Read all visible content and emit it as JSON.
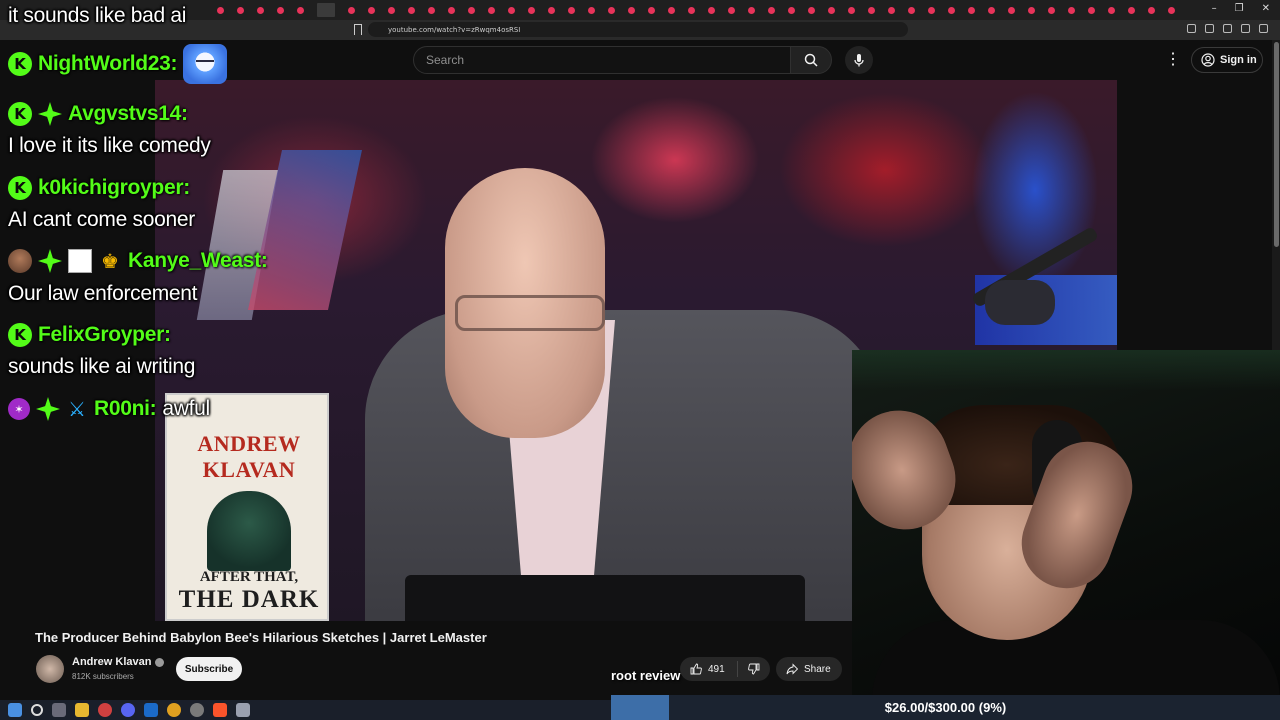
{
  "browser": {
    "url": "youtube.com/watch?v=zRwqm4osRSI"
  },
  "youtube": {
    "search_placeholder": "Search",
    "sign_in": "Sign in",
    "video_title": "The Producer Behind Babylon Bee's Hilarious Sketches | Jarret LeMaster",
    "channel_name": "Andrew Klavan",
    "subscribers": "812K subscribers",
    "subscribe": "Subscribe",
    "likes": "491",
    "share": "Share"
  },
  "book": {
    "author_line1": "ANDREW",
    "author_line2": "KLAVAN",
    "title_line1": "AFTER THAT,",
    "title_line2": "THE DARK"
  },
  "chat": {
    "messages": [
      {
        "text": "it sounds like bad ai"
      },
      {
        "user": "NightWorld23:"
      },
      {
        "user": "Avgvstvs14:",
        "text": "I love it its like comedy"
      },
      {
        "user": "k0kichigroyper:",
        "text": "AI cant come sooner"
      },
      {
        "user": "Kanye_Weast:",
        "text": "Our law enforcement"
      },
      {
        "user": "FelixGroyper:",
        "text": "sounds like ai writing"
      },
      {
        "user": "R00ni:",
        "text": "awful"
      }
    ]
  },
  "overlay": {
    "root_review": "root review",
    "goal_text": "$26.00/$300.00 (9%)",
    "goal_fraction": 0.087
  },
  "colors": {
    "chat_user": "#53fc18",
    "goal_fill": "#3d6ea8",
    "tab_dot": "#e8335a"
  }
}
